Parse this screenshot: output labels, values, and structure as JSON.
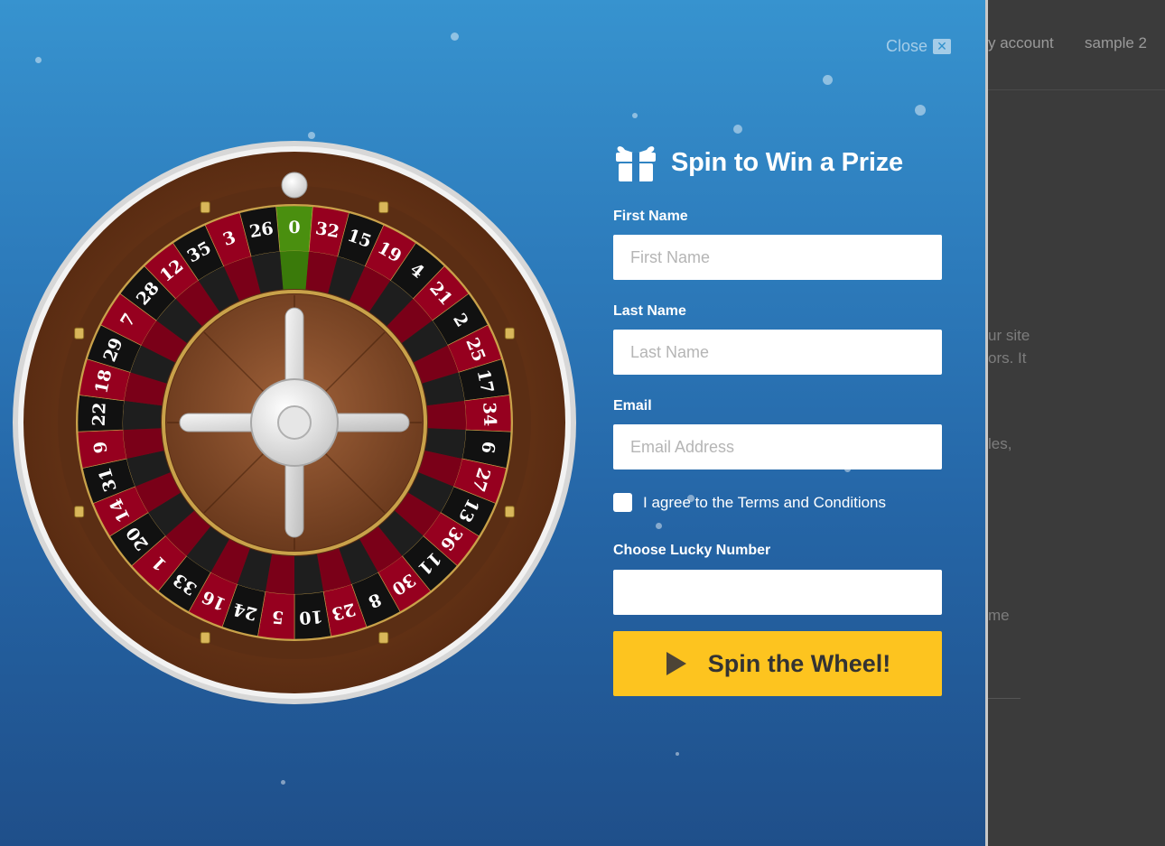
{
  "background_page": {
    "nav": [
      "y account",
      "sample 2"
    ],
    "text_fragments": [
      "ur site",
      "ors. It",
      "les,",
      "me"
    ]
  },
  "popup": {
    "close_label": "Close",
    "title": "Spin to Win a Prize",
    "fields": {
      "first_name": {
        "label": "First Name",
        "placeholder": "First Name",
        "value": ""
      },
      "last_name": {
        "label": "Last Name",
        "placeholder": "Last Name",
        "value": ""
      },
      "email": {
        "label": "Email",
        "placeholder": "Email Address",
        "value": ""
      },
      "lucky_number": {
        "label": "Choose Lucky Number",
        "placeholder": "",
        "value": ""
      }
    },
    "agree": {
      "label": "I agree to the Terms and Conditions",
      "checked": false
    },
    "spin_button": "Spin the Wheel!"
  },
  "wheel": {
    "numbers": [
      "0",
      "32",
      "15",
      "19",
      "4",
      "21",
      "2",
      "25",
      "17",
      "34",
      "6",
      "27",
      "13",
      "36",
      "11",
      "30",
      "8",
      "23",
      "10",
      "5",
      "24",
      "16",
      "33",
      "1",
      "20",
      "14",
      "31",
      "9",
      "22",
      "18",
      "29",
      "7",
      "28",
      "12",
      "35",
      "3",
      "26"
    ],
    "colors": {
      "red": "#96001f",
      "black": "#111111",
      "green": "#4a8f0f",
      "wood": "#6e3b1c",
      "accent": "#fdc41f"
    }
  }
}
